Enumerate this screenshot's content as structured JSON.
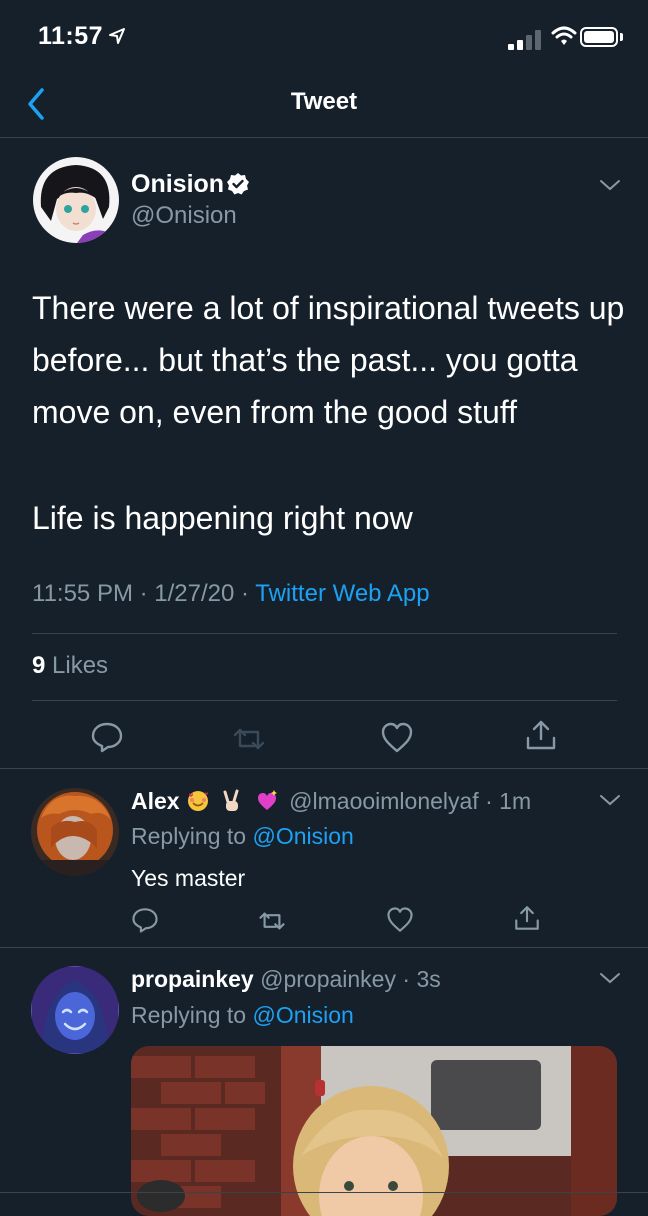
{
  "status_bar": {
    "time": "11:57"
  },
  "nav": {
    "title": "Tweet"
  },
  "tweet": {
    "author_name": "Onision",
    "author_handle": "@Onision",
    "text_paragraph_1": "There were a lot of inspirational tweets up before... but that’s the past... you gotta move on, even from the good stuff",
    "text_paragraph_2": "Life is happening right now",
    "time": "11:55 PM",
    "sep1": " · ",
    "date": "1/27/20",
    "sep2": " · ",
    "source": "Twitter Web App",
    "likes_count": "9",
    "likes_label": " Likes"
  },
  "replies": [
    {
      "name": "Alex",
      "handle": "@lmaooimlonelyaf",
      "dot": " · ",
      "time": "1m",
      "replying_prefix": "Replying to ",
      "replying_to": "@Onision",
      "text": "Yes master"
    },
    {
      "name": "propainkey",
      "handle": "@propainkey",
      "dot": " · ",
      "time": "3s",
      "replying_prefix": "Replying to ",
      "replying_to": "@Onision"
    }
  ],
  "colors": {
    "background": "#15202b",
    "secondary_text": "#8899a6",
    "accent": "#1da1f2",
    "divider": "#38444d"
  }
}
